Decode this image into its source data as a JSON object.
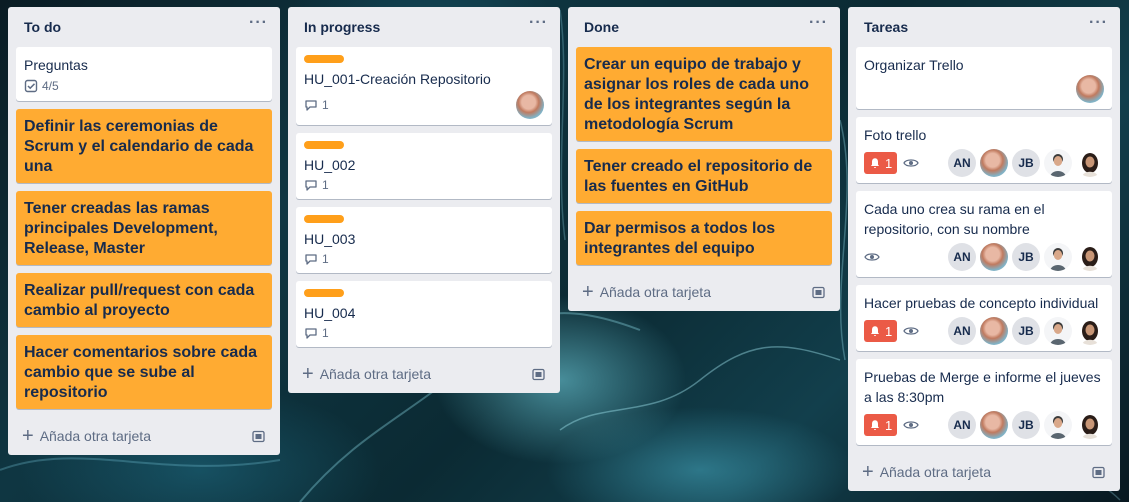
{
  "lists": [
    {
      "title": "To do",
      "cards": [
        {
          "title": "Preguntas",
          "checklist": "4/5"
        },
        {
          "title": "Definir las ceremonias de Scrum y el calendario de cada una"
        },
        {
          "title": "Tener creadas las ramas principales Development, Release, Master"
        },
        {
          "title": "Realizar pull/request con cada cambio al proyecto"
        },
        {
          "title": "Hacer comentarios sobre cada cambio que se sube al repositorio"
        }
      ]
    },
    {
      "title": "In progress",
      "cards": [
        {
          "title": "HU_001-Creación Repositorio",
          "comments": "1"
        },
        {
          "title": "HU_002",
          "comments": "1"
        },
        {
          "title": "HU_003",
          "comments": "1"
        },
        {
          "title": "HU_004",
          "comments": "1"
        }
      ]
    },
    {
      "title": "Done",
      "cards": [
        {
          "title": "Crear un equipo de trabajo y asignar los roles de cada uno de los integrantes según la metodología Scrum"
        },
        {
          "title": "Tener creado el repositorio de las fuentes en GitHub"
        },
        {
          "title": "Dar permisos a todos los integrantes del equipo"
        }
      ]
    },
    {
      "title": "Tareas",
      "cards": [
        {
          "title": "Organizar Trello"
        },
        {
          "title": "Foto trello",
          "alert": "1"
        },
        {
          "title": "Cada uno crea su rama en el repositorio, con su nombre"
        },
        {
          "title": "Hacer pruebas de concepto individual",
          "alert": "1"
        },
        {
          "title": "Pruebas de Merge e informe el jueves a las 8:30pm",
          "alert": "1"
        }
      ]
    }
  ],
  "members": {
    "an": "AN",
    "jb": "JB"
  },
  "list_menu": "···",
  "add_card_label": "Añada otra tarjeta",
  "colors": {
    "card_orange": "#ffab32",
    "label_orange": "#ff9f1a",
    "alert_red": "#eb5a46",
    "list_bg": "#ebecf0"
  },
  "icons": [
    "checklist-icon",
    "comment-icon",
    "bell-icon",
    "eye-icon",
    "plus-icon",
    "template-icon"
  ]
}
